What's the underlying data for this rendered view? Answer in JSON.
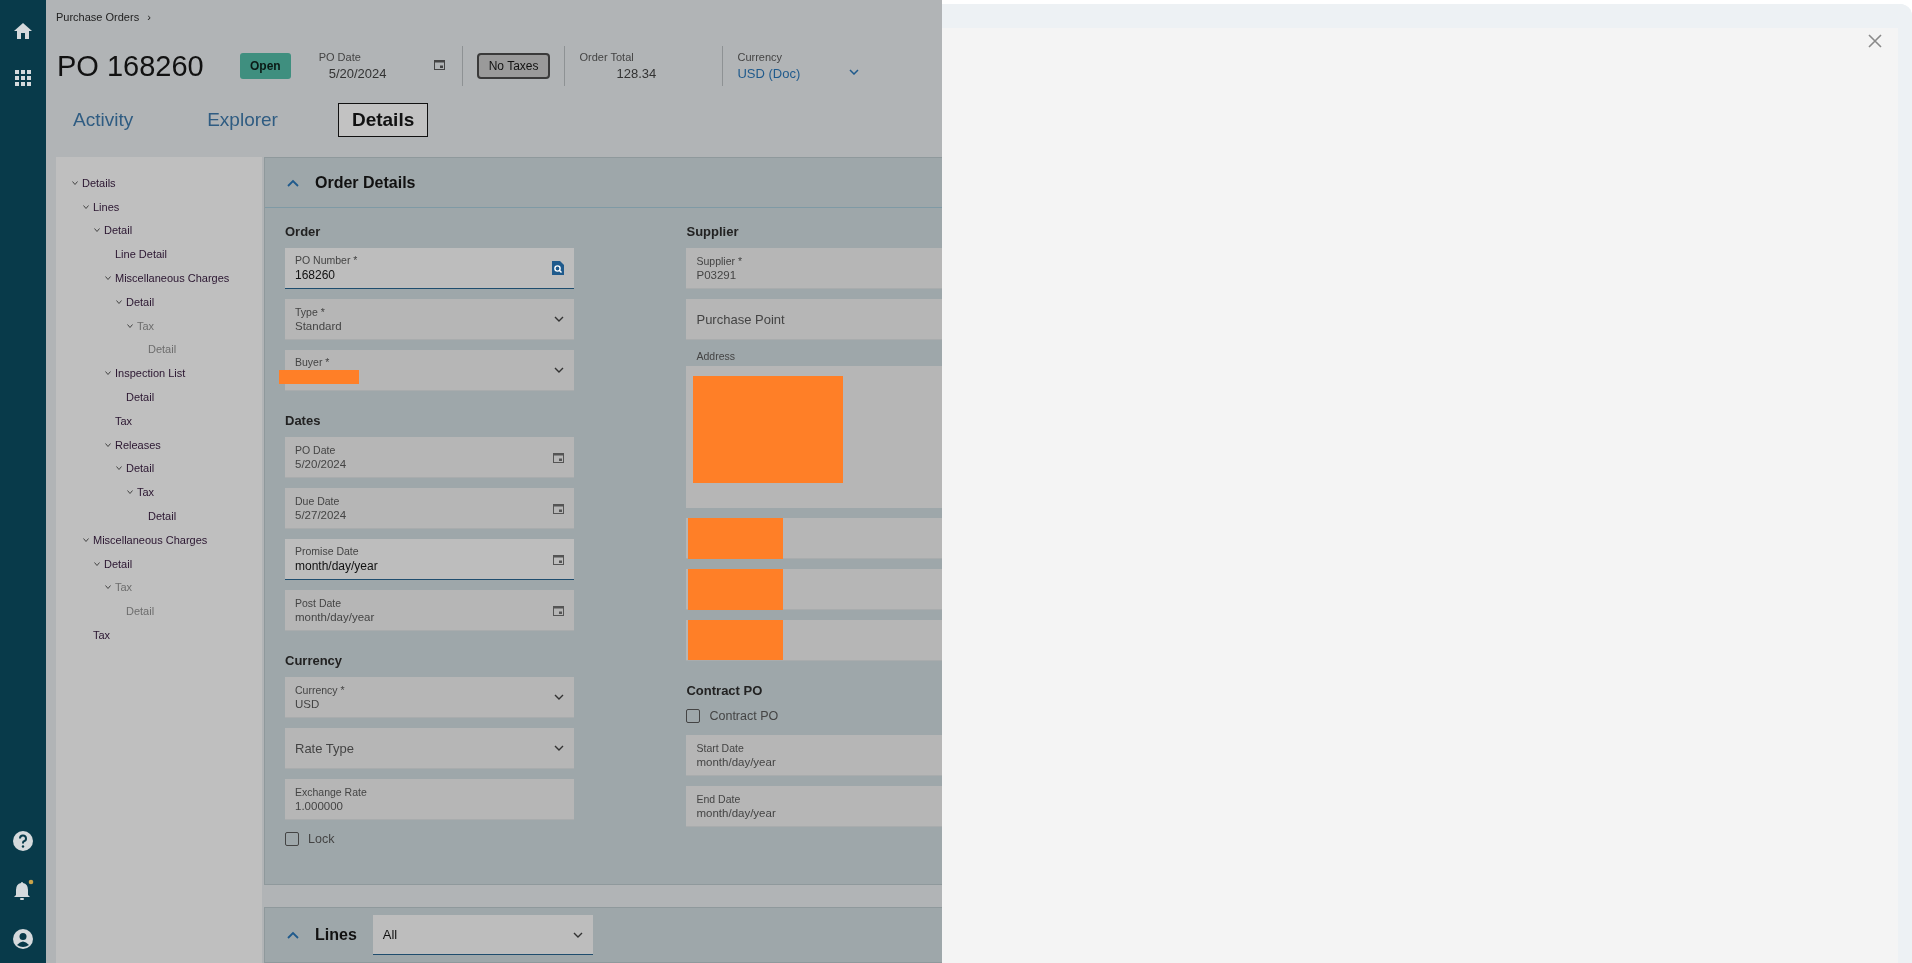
{
  "breadcrumb": {
    "label": "Purchase Orders",
    "separator": "›"
  },
  "header": {
    "title": "PO 168260",
    "status": "Open",
    "po_date": {
      "label": "PO Date",
      "value": "5/20/2024"
    },
    "tax_button": "No Taxes",
    "order_total": {
      "label": "Order Total",
      "value": "128.34"
    },
    "currency": {
      "label": "Currency",
      "value": "USD (Doc)"
    }
  },
  "tabs": [
    {
      "label": "Activity",
      "selected": false
    },
    {
      "label": "Explorer",
      "selected": false
    },
    {
      "label": "Details",
      "selected": true
    }
  ],
  "tree": [
    {
      "label": "Details",
      "expanded": true,
      "disabled": false,
      "children": [
        {
          "label": "Lines",
          "expanded": true,
          "disabled": false,
          "children": [
            {
              "label": "Detail",
              "expanded": true,
              "disabled": false,
              "children": [
                {
                  "label": "Line Detail",
                  "disabled": false
                },
                {
                  "label": "Miscellaneous Charges",
                  "expanded": true,
                  "disabled": false,
                  "children": [
                    {
                      "label": "Detail",
                      "expanded": true,
                      "disabled": false,
                      "children": [
                        {
                          "label": "Tax",
                          "expanded": true,
                          "disabled": true,
                          "children": [
                            {
                              "label": "Detail",
                              "disabled": true
                            }
                          ]
                        }
                      ]
                    }
                  ]
                },
                {
                  "label": "Inspection List",
                  "expanded": true,
                  "disabled": false,
                  "children": [
                    {
                      "label": "Detail",
                      "disabled": false
                    }
                  ]
                },
                {
                  "label": "Tax",
                  "disabled": false
                },
                {
                  "label": "Releases",
                  "expanded": true,
                  "disabled": false,
                  "children": [
                    {
                      "label": "Detail",
                      "expanded": true,
                      "disabled": false,
                      "children": [
                        {
                          "label": "Tax",
                          "expanded": true,
                          "disabled": false,
                          "children": [
                            {
                              "label": "Detail",
                              "disabled": false
                            }
                          ]
                        }
                      ]
                    }
                  ]
                }
              ]
            }
          ]
        },
        {
          "label": "Miscellaneous Charges",
          "expanded": true,
          "disabled": false,
          "children": [
            {
              "label": "Detail",
              "expanded": true,
              "disabled": false,
              "children": [
                {
                  "label": "Tax",
                  "expanded": true,
                  "disabled": true,
                  "children": [
                    {
                      "label": "Detail",
                      "disabled": true
                    }
                  ]
                }
              ]
            }
          ]
        },
        {
          "label": "Tax",
          "disabled": false
        }
      ]
    }
  ],
  "order_details": {
    "title": "Order Details",
    "expanded": true,
    "columns": [
      [
        {
          "heading": "Order",
          "items": [
            {
              "kind": "lookup",
              "label": "PO Number *",
              "value": "168260",
              "active": true
            },
            {
              "kind": "dropdown",
              "label": "Type *",
              "value": "Standard",
              "active": false
            },
            {
              "kind": "dropdown",
              "label": "Buyer *",
              "redacted": true,
              "active": false
            }
          ]
        },
        {
          "heading": "Dates",
          "items": [
            {
              "kind": "date",
              "label": "PO Date",
              "value": "5/20/2024",
              "active": false
            },
            {
              "kind": "date",
              "label": "Due Date",
              "value": "5/27/2024",
              "active": false
            },
            {
              "kind": "date",
              "label": "Promise Date",
              "placeholder": "month/day/year",
              "active": true
            },
            {
              "kind": "date",
              "label": "Post Date",
              "placeholder": "month/day/year",
              "active": false
            }
          ]
        },
        {
          "heading": "Currency",
          "items": [
            {
              "kind": "dropdown",
              "label": "Currency *",
              "value": "USD",
              "active": false
            },
            {
              "kind": "dropdown",
              "label": "Rate Type",
              "active": false
            },
            {
              "kind": "text",
              "label": "Exchange Rate",
              "value": "1.000000",
              "active": false
            },
            {
              "kind": "checkbox",
              "label": "Lock",
              "checked": false
            }
          ]
        }
      ],
      [
        {
          "heading": "Supplier",
          "items": [
            {
              "kind": "text",
              "label": "Supplier *",
              "value": "P03291",
              "active": false
            },
            {
              "kind": "text",
              "label": "Purchase Point",
              "active": false
            },
            {
              "kind": "textarea",
              "label": "Address",
              "redacted": true
            },
            {
              "kind": "blank",
              "redacted": true
            },
            {
              "kind": "blank",
              "redacted": true
            },
            {
              "kind": "blank",
              "redacted": true
            }
          ]
        },
        {
          "heading": "Contract PO",
          "items": [
            {
              "kind": "checkbox",
              "label": "Contract PO",
              "checked": false
            },
            {
              "kind": "text",
              "label": "Start Date",
              "placeholder": "month/day/year",
              "active": false
            },
            {
              "kind": "text",
              "label": "End Date",
              "placeholder": "month/day/year",
              "active": false
            }
          ]
        }
      ]
    ]
  },
  "lines": {
    "title": "Lines",
    "expanded": true,
    "filter": "All"
  }
}
